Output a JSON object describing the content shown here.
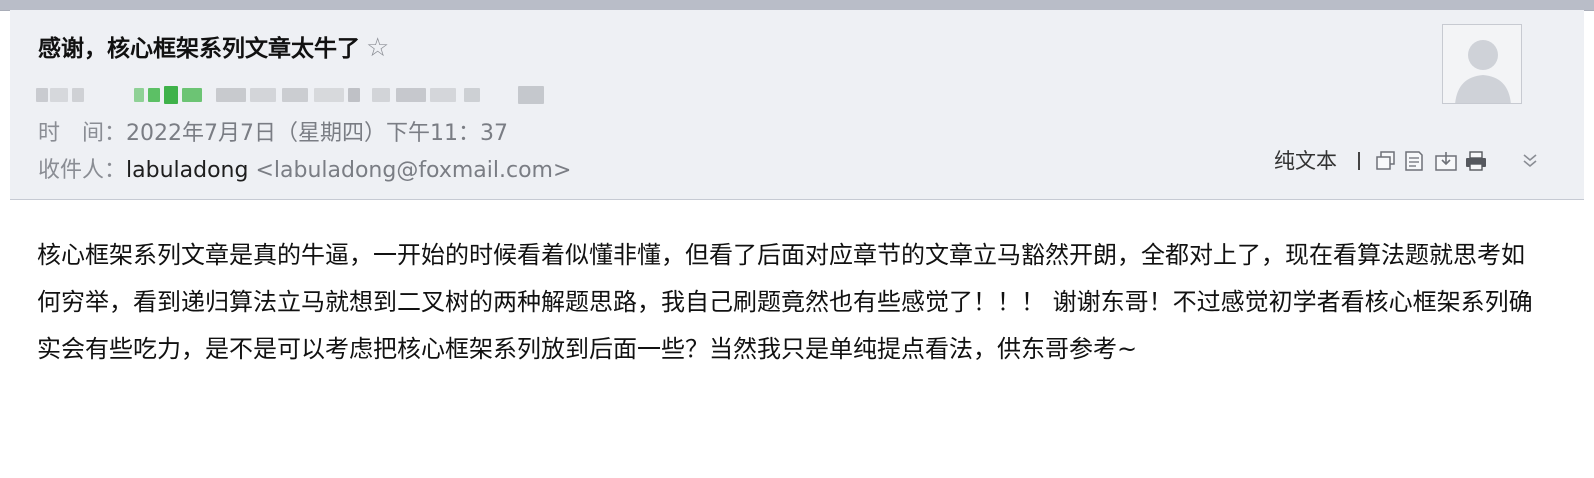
{
  "email": {
    "subject": "感谢，核心框架系列文章太牛了",
    "star_icon": "star-outline-icon",
    "time_label": "时　间：",
    "time_value": "2022年7月7日（星期四）下午11：37",
    "recipient_label": "收件人：",
    "recipient_name": "labuladong",
    "recipient_email": "<labuladong@foxmail.com>",
    "body": "核心框架系列文章是真的牛逼，一开始的时候看着似懂非懂，但看了后面对应章节的文章立马豁然开朗，全都对上了，现在看算法题就思考如何穷举，看到递归算法立马就想到二叉树的两种解题思路，我自己刷题竟然也有些感觉了！！！ 谢谢东哥！不过感觉初学者看核心框架系列确实会有些吃力，是不是可以考虑把核心框架系列放到后面一些？当然我只是单纯提点看法，供东哥参考~"
  },
  "toolbar": {
    "plain_text_label": "纯文本",
    "icons": [
      "copy-icon",
      "note-icon",
      "download-icon",
      "print-icon",
      "chevron-down-icon"
    ]
  },
  "colors": {
    "header_bg": "#eef0f4",
    "top_strip": "#b9bdc8",
    "sender_highlight": "#3fb24a"
  }
}
